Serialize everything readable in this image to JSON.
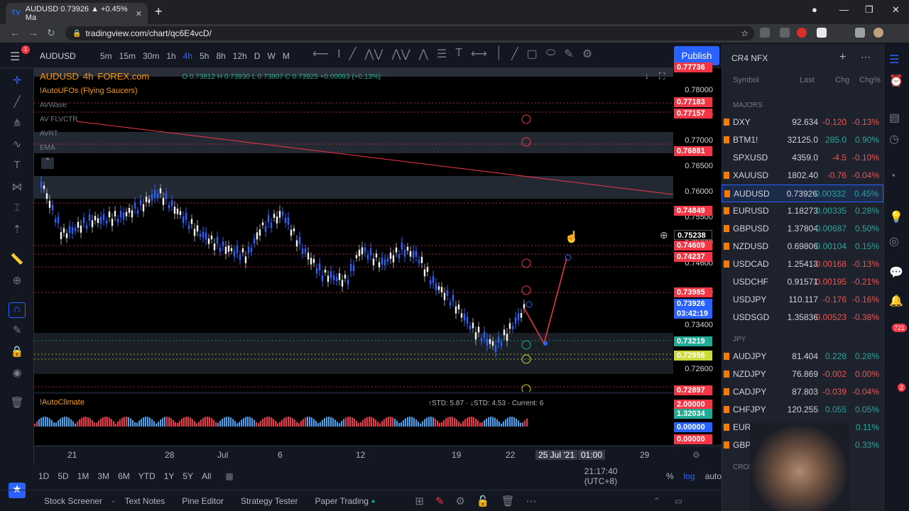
{
  "browser": {
    "tab_title": "AUDUSD 0.73926 ▲ +0.45% Ma",
    "tab_logo": "TV",
    "url": "tradingview.com/chart/qc6E4vcD/"
  },
  "toolbar": {
    "symbol": "AUDUSD",
    "timeframes": [
      "5m",
      "15m",
      "30m",
      "1h",
      "4h",
      "5h",
      "8h",
      "12h",
      "D",
      "W",
      "M"
    ],
    "active_tf": "4h",
    "publish": "Publish",
    "badge": "1"
  },
  "chart": {
    "header_symbol": "AUDUSD",
    "header_tf": "4h",
    "header_exchange": "FOREX.com",
    "ohlc": "O 0.73812 H 0.73930 L 0.73807 C 0.73925 +0.00093 (+0.13%)",
    "indicators": [
      "!AutoUFOs (Flying Saucers)",
      "AVWave",
      "AV FLVCTR",
      "AVRT",
      "EMA"
    ],
    "price_labels": [
      "0.78000",
      "0.77500",
      "0.77000",
      "0.76500",
      "0.76000",
      "0.75500",
      "0.75000",
      "0.74600",
      "0.74000",
      "0.73400",
      "0.72600"
    ],
    "price_tags": [
      {
        "v": "0.77736",
        "c": "#f23645"
      },
      {
        "v": "0.77183",
        "c": "#f23645"
      },
      {
        "v": "0.77157",
        "c": "#f23645"
      },
      {
        "v": "0.76881",
        "c": "#f23645"
      },
      {
        "v": "0.74849",
        "c": "#f23645"
      },
      {
        "v": "0.75238",
        "c": "#000000"
      },
      {
        "v": "0.74609",
        "c": "#f23645"
      },
      {
        "v": "0.74237",
        "c": "#f23645"
      },
      {
        "v": "0.73985",
        "c": "#f23645"
      },
      {
        "v": "0.73926",
        "c": "#2962ff"
      },
      {
        "v": "03:42:19",
        "c": "#2962ff"
      },
      {
        "v": "0.73219",
        "c": "#22ab94"
      },
      {
        "v": "0.72956",
        "c": "#cddc39"
      },
      {
        "v": "0.72897",
        "c": "#f23645"
      }
    ],
    "time_labels": [
      "21",
      "28",
      "Jul",
      "6",
      "12",
      "19",
      "22",
      "25 Jul '21",
      "01:00",
      "29"
    ]
  },
  "indicator_pane": {
    "name": "!AutoClimate",
    "stats": "↑STD: 5.87 · ↓STD: 4.53 · Current: 6",
    "tags": [
      {
        "v": "2.00000",
        "c": "#f23645"
      },
      {
        "v": "1.32034",
        "c": "#22ab94"
      },
      {
        "v": "0.00000",
        "c": "#2962ff"
      },
      {
        "v": "0.00000",
        "c": "#f23645"
      }
    ]
  },
  "range": {
    "buttons": [
      "1D",
      "5D",
      "1M",
      "3M",
      "6M",
      "YTD",
      "1Y",
      "5Y",
      "All"
    ],
    "time": "21:17:40 (UTC+8)",
    "pct": "%",
    "log": "log",
    "auto": "auto"
  },
  "bottom": {
    "tabs": [
      "Stock Screener",
      "Text Notes",
      "Pine Editor",
      "Strategy Tester",
      "Paper Trading"
    ]
  },
  "watchlist": {
    "title": "CR4 NFX",
    "cols": [
      "Symbol",
      "Last",
      "Chg",
      "Chg%"
    ],
    "sections": [
      "MAJORS",
      "JPY",
      "CROSS"
    ],
    "rows": [
      {
        "s": "DXY",
        "l": "92.634",
        "c": "-0.120",
        "p": "-0.13%",
        "d": "dn"
      },
      {
        "s": "BTM1!",
        "l": "32125.0",
        "c": "285.0",
        "p": "0.90%",
        "d": "up"
      },
      {
        "s": "SPXUSD",
        "l": "4359.0",
        "c": "-4.5",
        "p": "-0.10%",
        "d": "dn"
      },
      {
        "s": "XAUUSD",
        "l": "1802.40",
        "c": "-0.76",
        "p": "-0.04%",
        "d": "dn"
      },
      {
        "s": "AUDUSD",
        "l": "0.73926",
        "c": "0.00332",
        "p": "0.45%",
        "d": "up"
      },
      {
        "s": "EURUSD",
        "l": "1.18273",
        "c": "0.00335",
        "p": "0.28%",
        "d": "up"
      },
      {
        "s": "GBPUSD",
        "l": "1.37804",
        "c": "0.00687",
        "p": "0.50%",
        "d": "up"
      },
      {
        "s": "NZDUSD",
        "l": "0.69806",
        "c": "0.00104",
        "p": "0.15%",
        "d": "up"
      },
      {
        "s": "USDCAD",
        "l": "1.25413",
        "c": "-0.00168",
        "p": "-0.13%",
        "d": "dn"
      },
      {
        "s": "USDCHF",
        "l": "0.91571",
        "c": "-0.00195",
        "p": "-0.21%",
        "d": "dn"
      },
      {
        "s": "USDJPY",
        "l": "110.117",
        "c": "-0.176",
        "p": "-0.16%",
        "d": "dn"
      },
      {
        "s": "USDSGD",
        "l": "1.35836",
        "c": "-0.00523",
        "p": "-0.38%",
        "d": "dn"
      },
      {
        "s": "AUDJPY",
        "l": "81.404",
        "c": "0.228",
        "p": "0.28%",
        "d": "up"
      },
      {
        "s": "NZDJPY",
        "l": "76.869",
        "c": "-0.002",
        "p": "0.00%",
        "d": "dn"
      },
      {
        "s": "CADJPY",
        "l": "87.803",
        "c": "-0.039",
        "p": "-0.04%",
        "d": "dn"
      },
      {
        "s": "CHFJPY",
        "l": "120.255",
        "c": "0.055",
        "p": "0.05%",
        "d": "up"
      },
      {
        "s": "EURJPY",
        "l": "",
        "c": "0.145",
        "p": "0.11%",
        "d": "up"
      },
      {
        "s": "GBPJPY",
        "l": "",
        "c": "0.503",
        "p": "0.33%",
        "d": "up"
      }
    ]
  },
  "right_strip": {
    "badge1": "721",
    "badge2": "2"
  }
}
